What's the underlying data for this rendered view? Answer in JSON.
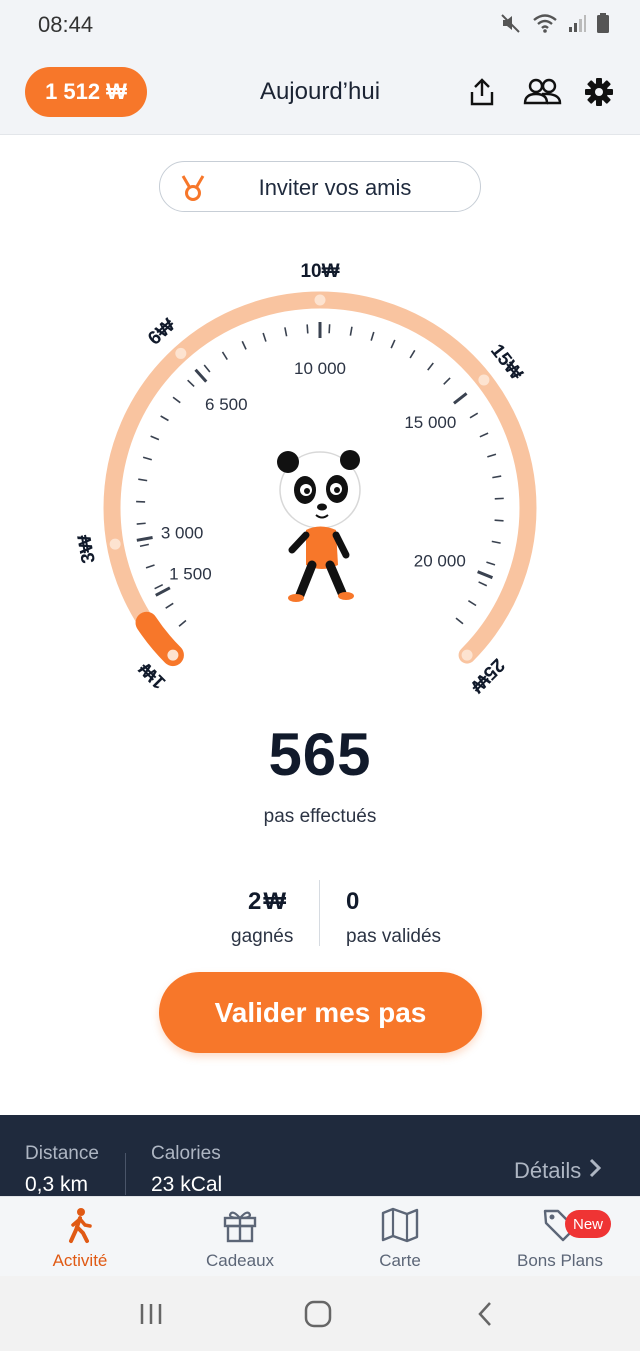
{
  "status_bar": {
    "time": "08:44",
    "icons": [
      "mute-icon",
      "wifi-icon",
      "signal-icon",
      "battery-icon"
    ]
  },
  "header": {
    "balance": "1 512",
    "currency_symbol": "₩",
    "title": "Aujourd’hui",
    "icons": [
      "share-icon",
      "friends-icon",
      "settings-icon"
    ]
  },
  "invite": {
    "label": "Inviter vos amis",
    "icon": "medal-icon"
  },
  "gauge": {
    "reward_labels": [
      {
        "text": "1₩",
        "steps": 0
      },
      {
        "text": "3₩",
        "steps": 3000
      },
      {
        "text": "6₩",
        "steps": 6500
      },
      {
        "text": "10₩",
        "steps": 10000
      },
      {
        "text": "15₩",
        "steps": 15000
      },
      {
        "text": "25₩",
        "steps": 25000
      }
    ],
    "step_labels": [
      "1 500",
      "3 000",
      "6 500",
      "10 000",
      "15 000",
      "20 000"
    ],
    "current_steps": 565,
    "max_steps": 25000,
    "track_color": "#f9c4a0",
    "progress_color": "#f7772a",
    "mascot": "panda-mascot"
  },
  "steps": {
    "count": "565",
    "caption": "pas effectués"
  },
  "stats": {
    "earned_value": "2",
    "earned_label": "gagnés",
    "validated_value": "0",
    "validated_label": "pas validés"
  },
  "validate_button": {
    "label": "Valider mes pas"
  },
  "summary": {
    "distance_label": "Distance",
    "distance_value": "0,3 km",
    "calories_label": "Calories",
    "calories_value": "23 kCal",
    "details_label": "Détails"
  },
  "tabs": [
    {
      "label": "Activité",
      "icon": "walking-icon",
      "active": true
    },
    {
      "label": "Cadeaux",
      "icon": "gift-icon",
      "active": false
    },
    {
      "label": "Carte",
      "icon": "map-icon",
      "active": false
    },
    {
      "label": "Bons Plans",
      "icon": "tag-icon",
      "active": false
    }
  ],
  "badge_new": "New",
  "colors": {
    "accent": "#f7772a",
    "dark": "#1f2a3d",
    "text": "#1b2333"
  }
}
